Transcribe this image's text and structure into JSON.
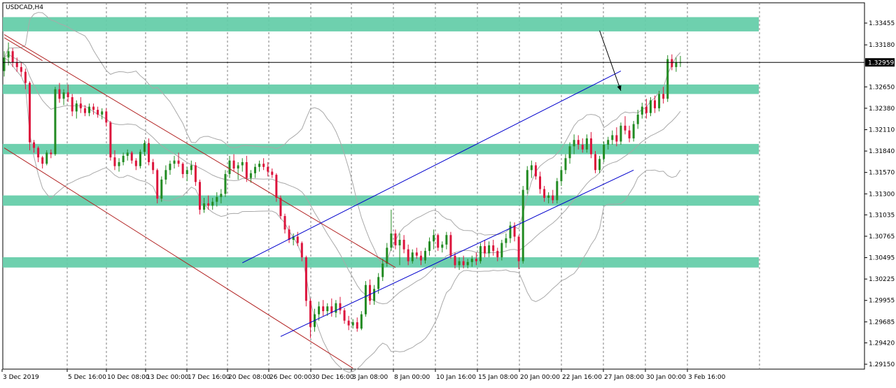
{
  "chart_data": {
    "type": "candlestick",
    "symbol_label": "USDCAD,H4",
    "current_price_label": "1.32959",
    "current_price": 1.32959,
    "ylim": [
      1.2905,
      1.3372
    ],
    "y_ticks": [
      "1.33455",
      "1.33180",
      "1.32650",
      "1.32380",
      "1.32110",
      "1.31840",
      "1.31570",
      "1.31300",
      "1.31035",
      "1.30765",
      "1.30495",
      "1.30225",
      "1.29955",
      "1.29685",
      "1.29420",
      "1.29150"
    ],
    "x_labels": [
      "3 Dec 2019",
      "5 Dec 16:00",
      "10 Dec 08:00",
      "13 Dec 00:00",
      "17 Dec 16:00",
      "20 Dec 08:00",
      "26 Dec 00:00",
      "30 Dec 16:00",
      "3 Jan 08:00",
      "8 Jan 00:00",
      "10 Jan 16:00",
      "15 Jan 08:00",
      "20 Jan 00:00",
      "22 Jan 16:00",
      "27 Jan 08:00",
      "30 Jan 00:00",
      "3 Feb 16:00"
    ],
    "bar_count": 160,
    "zones": [
      {
        "low": 1.3335,
        "high": 1.3353
      },
      {
        "low": 1.3256,
        "high": 1.3268
      },
      {
        "low": 1.318,
        "high": 1.3193
      },
      {
        "low": 1.3115,
        "high": 1.3128
      },
      {
        "low": 1.3037,
        "high": 1.305
      }
    ],
    "trend_lines": [
      {
        "color": "#b22222",
        "points": [
          [
            0,
            1.3327
          ],
          [
            9,
            1.3298
          ]
        ]
      },
      {
        "color": "#b22222",
        "points": [
          [
            0,
            1.3331
          ],
          [
            92,
            1.3037
          ]
        ]
      },
      {
        "color": "#b22222",
        "points": [
          [
            0,
            1.3188
          ],
          [
            82,
            1.291
          ]
        ]
      },
      {
        "color": "#0000cd",
        "points": [
          [
            56,
            1.3043
          ],
          [
            145,
            1.3285
          ]
        ]
      },
      {
        "color": "#0000cd",
        "points": [
          [
            65,
            1.295
          ],
          [
            148,
            1.316
          ]
        ]
      }
    ],
    "arrows": [
      {
        "color": "#000000",
        "from": [
          140,
          1.3336
        ],
        "to": [
          145,
          1.326
        ]
      }
    ],
    "ohlc": [
      [
        1.3285,
        1.331,
        1.3278,
        1.3302
      ],
      [
        1.3302,
        1.3321,
        1.3292,
        1.331
      ],
      [
        1.331,
        1.3314,
        1.329,
        1.3296
      ],
      [
        1.3296,
        1.3302,
        1.3284,
        1.329
      ],
      [
        1.329,
        1.3296,
        1.3278,
        1.3284
      ],
      [
        1.3284,
        1.3288,
        1.3262,
        1.327
      ],
      [
        1.327,
        1.3272,
        1.3185,
        1.3195
      ],
      [
        1.3195,
        1.3198,
        1.3182,
        1.3188
      ],
      [
        1.3188,
        1.319,
        1.317,
        1.3176
      ],
      [
        1.3176,
        1.3178,
        1.3162,
        1.3168
      ],
      [
        1.3168,
        1.3185,
        1.3166,
        1.3182
      ],
      [
        1.3182,
        1.3186,
        1.3175,
        1.318
      ],
      [
        1.318,
        1.3265,
        1.3178,
        1.3262
      ],
      [
        1.3262,
        1.327,
        1.3245,
        1.325
      ],
      [
        1.325,
        1.3262,
        1.3242,
        1.3258
      ],
      [
        1.3258,
        1.3268,
        1.3246,
        1.3252
      ],
      [
        1.3252,
        1.3256,
        1.3228,
        1.3234
      ],
      [
        1.3234,
        1.3248,
        1.3225,
        1.3244
      ],
      [
        1.3244,
        1.3252,
        1.3232,
        1.3238
      ],
      [
        1.3238,
        1.3242,
        1.3228,
        1.3232
      ],
      [
        1.3232,
        1.3244,
        1.3228,
        1.324
      ],
      [
        1.324,
        1.3244,
        1.323,
        1.3236
      ],
      [
        1.3236,
        1.324,
        1.3226,
        1.323
      ],
      [
        1.323,
        1.3238,
        1.3224,
        1.3234
      ],
      [
        1.3234,
        1.3238,
        1.3215,
        1.322
      ],
      [
        1.322,
        1.3222,
        1.3172,
        1.3176
      ],
      [
        1.3176,
        1.3185,
        1.316,
        1.3165
      ],
      [
        1.3165,
        1.3175,
        1.3158,
        1.317
      ],
      [
        1.317,
        1.3182,
        1.3166,
        1.3178
      ],
      [
        1.3178,
        1.3186,
        1.3172,
        1.3182
      ],
      [
        1.3182,
        1.3184,
        1.3168,
        1.3172
      ],
      [
        1.3172,
        1.3175,
        1.316,
        1.3165
      ],
      [
        1.3165,
        1.3186,
        1.3162,
        1.3183
      ],
      [
        1.3183,
        1.3198,
        1.3178,
        1.3194
      ],
      [
        1.3194,
        1.32,
        1.3166,
        1.317
      ],
      [
        1.317,
        1.3174,
        1.3155,
        1.316
      ],
      [
        1.316,
        1.3162,
        1.3118,
        1.3124
      ],
      [
        1.3124,
        1.3152,
        1.312,
        1.3148
      ],
      [
        1.3148,
        1.3166,
        1.3142,
        1.316
      ],
      [
        1.316,
        1.3172,
        1.3154,
        1.3168
      ],
      [
        1.3168,
        1.3178,
        1.3162,
        1.3172
      ],
      [
        1.3172,
        1.3182,
        1.3164,
        1.3168
      ],
      [
        1.3168,
        1.317,
        1.315,
        1.3155
      ],
      [
        1.3155,
        1.3164,
        1.3146,
        1.316
      ],
      [
        1.316,
        1.3172,
        1.3154,
        1.3166
      ],
      [
        1.3166,
        1.317,
        1.314,
        1.3145
      ],
      [
        1.3145,
        1.3148,
        1.3104,
        1.311
      ],
      [
        1.311,
        1.3125,
        1.3106,
        1.3118
      ],
      [
        1.3118,
        1.3128,
        1.311,
        1.3115
      ],
      [
        1.3115,
        1.3125,
        1.311,
        1.312
      ],
      [
        1.312,
        1.3132,
        1.3114,
        1.3126
      ],
      [
        1.3126,
        1.3136,
        1.3118,
        1.313
      ],
      [
        1.313,
        1.316,
        1.3126,
        1.3155
      ],
      [
        1.3155,
        1.3178,
        1.315,
        1.3172
      ],
      [
        1.3172,
        1.318,
        1.3158,
        1.3162
      ],
      [
        1.3162,
        1.317,
        1.3148,
        1.3166
      ],
      [
        1.3166,
        1.3175,
        1.3158,
        1.317
      ],
      [
        1.317,
        1.3178,
        1.3145,
        1.315
      ],
      [
        1.315,
        1.316,
        1.3144,
        1.3156
      ],
      [
        1.3156,
        1.3168,
        1.315,
        1.3164
      ],
      [
        1.3164,
        1.3172,
        1.3158,
        1.3168
      ],
      [
        1.3168,
        1.3175,
        1.316,
        1.3164
      ],
      [
        1.3164,
        1.317,
        1.3152,
        1.3158
      ],
      [
        1.3158,
        1.3162,
        1.315,
        1.3154
      ],
      [
        1.3154,
        1.3156,
        1.312,
        1.3125
      ],
      [
        1.3125,
        1.3128,
        1.3098,
        1.3102
      ],
      [
        1.3102,
        1.3105,
        1.308,
        1.3085
      ],
      [
        1.3085,
        1.309,
        1.3068,
        1.3072
      ],
      [
        1.3072,
        1.308,
        1.3065,
        1.3076
      ],
      [
        1.3076,
        1.3082,
        1.3064,
        1.3068
      ],
      [
        1.3068,
        1.307,
        1.3045,
        1.305
      ],
      [
        1.305,
        1.3052,
        1.2988,
        1.2995
      ],
      [
        1.2995,
        1.2998,
        1.2948,
        1.2962
      ],
      [
        1.2962,
        1.2985,
        1.2956,
        1.2978
      ],
      [
        1.2978,
        1.2994,
        1.297,
        1.2988
      ],
      [
        1.2988,
        1.2996,
        1.2976,
        1.2982
      ],
      [
        1.2982,
        1.2992,
        1.2976,
        1.2988
      ],
      [
        1.2988,
        1.2998,
        1.2975,
        1.298
      ],
      [
        1.298,
        1.2996,
        1.2974,
        1.2992
      ],
      [
        1.2992,
        1.3,
        1.2978,
        1.2983
      ],
      [
        1.2983,
        1.2986,
        1.2966,
        1.297
      ],
      [
        1.297,
        1.2976,
        1.2958,
        1.2964
      ],
      [
        1.2964,
        1.2972,
        1.296,
        1.2968
      ],
      [
        1.2968,
        1.2974,
        1.2956,
        1.296
      ],
      [
        1.296,
        1.2982,
        1.2958,
        1.2978
      ],
      [
        1.2978,
        1.302,
        1.2975,
        1.3015
      ],
      [
        1.3015,
        1.3022,
        1.299,
        1.2995
      ],
      [
        1.2995,
        1.3015,
        1.299,
        1.301
      ],
      [
        1.301,
        1.303,
        1.3004,
        1.3025
      ],
      [
        1.3025,
        1.3048,
        1.302,
        1.3042
      ],
      [
        1.3042,
        1.3068,
        1.3038,
        1.3062
      ],
      [
        1.3062,
        1.311,
        1.3058,
        1.308
      ],
      [
        1.308,
        1.3085,
        1.306,
        1.3065
      ],
      [
        1.3065,
        1.308,
        1.304,
        1.3072
      ],
      [
        1.3072,
        1.3078,
        1.3055,
        1.306
      ],
      [
        1.306,
        1.3066,
        1.304,
        1.3045
      ],
      [
        1.3045,
        1.306,
        1.3042,
        1.3056
      ],
      [
        1.3056,
        1.3062,
        1.3048,
        1.3052
      ],
      [
        1.3052,
        1.3058,
        1.304,
        1.3046
      ],
      [
        1.3046,
        1.3062,
        1.3042,
        1.3058
      ],
      [
        1.3058,
        1.3075,
        1.3052,
        1.307
      ],
      [
        1.307,
        1.3085,
        1.306,
        1.3078
      ],
      [
        1.3078,
        1.308,
        1.3058,
        1.3062
      ],
      [
        1.3062,
        1.307,
        1.3056,
        1.3066
      ],
      [
        1.3066,
        1.3082,
        1.306,
        1.3078
      ],
      [
        1.3078,
        1.3082,
        1.3048,
        1.3052
      ],
      [
        1.3052,
        1.3056,
        1.3036,
        1.304
      ],
      [
        1.304,
        1.305,
        1.3034,
        1.3045
      ],
      [
        1.3045,
        1.3052,
        1.3036,
        1.304
      ],
      [
        1.304,
        1.3048,
        1.3036,
        1.3044
      ],
      [
        1.3044,
        1.3052,
        1.3038,
        1.3048
      ],
      [
        1.3048,
        1.3056,
        1.304,
        1.3045
      ],
      [
        1.3045,
        1.3068,
        1.3042,
        1.3064
      ],
      [
        1.3064,
        1.3072,
        1.305,
        1.3055
      ],
      [
        1.3055,
        1.307,
        1.305,
        1.3065
      ],
      [
        1.3065,
        1.3072,
        1.3052,
        1.3058
      ],
      [
        1.3058,
        1.3062,
        1.3045,
        1.305
      ],
      [
        1.305,
        1.3072,
        1.3046,
        1.3068
      ],
      [
        1.3068,
        1.308,
        1.3062,
        1.3074
      ],
      [
        1.3074,
        1.3095,
        1.3068,
        1.309
      ],
      [
        1.309,
        1.3094,
        1.307,
        1.3076
      ],
      [
        1.3076,
        1.3078,
        1.3035,
        1.3045
      ],
      [
        1.3045,
        1.314,
        1.3042,
        1.3135
      ],
      [
        1.3135,
        1.3165,
        1.313,
        1.316
      ],
      [
        1.316,
        1.3172,
        1.315,
        1.3166
      ],
      [
        1.3166,
        1.317,
        1.3148,
        1.3152
      ],
      [
        1.3152,
        1.3158,
        1.313,
        1.3136
      ],
      [
        1.3136,
        1.314,
        1.312,
        1.3125
      ],
      [
        1.3125,
        1.3132,
        1.3118,
        1.3128
      ],
      [
        1.3128,
        1.3135,
        1.3118,
        1.3122
      ],
      [
        1.3122,
        1.315,
        1.3118,
        1.3146
      ],
      [
        1.3146,
        1.3165,
        1.314,
        1.316
      ],
      [
        1.316,
        1.318,
        1.3155,
        1.3175
      ],
      [
        1.3175,
        1.3195,
        1.3168,
        1.319
      ],
      [
        1.319,
        1.3205,
        1.318,
        1.3198
      ],
      [
        1.3198,
        1.3204,
        1.3186,
        1.3192
      ],
      [
        1.3192,
        1.32,
        1.3182,
        1.3186
      ],
      [
        1.3186,
        1.3205,
        1.3182,
        1.32
      ],
      [
        1.32,
        1.3208,
        1.3175,
        1.318
      ],
      [
        1.318,
        1.3184,
        1.3156,
        1.316
      ],
      [
        1.316,
        1.3178,
        1.3156,
        1.3174
      ],
      [
        1.3174,
        1.3196,
        1.317,
        1.3192
      ],
      [
        1.3192,
        1.3202,
        1.3186,
        1.3198
      ],
      [
        1.3198,
        1.321,
        1.3192,
        1.3204
      ],
      [
        1.3204,
        1.3214,
        1.319,
        1.3196
      ],
      [
        1.3196,
        1.322,
        1.3192,
        1.3216
      ],
      [
        1.3216,
        1.3228,
        1.3205,
        1.321
      ],
      [
        1.321,
        1.3216,
        1.3195,
        1.32
      ],
      [
        1.32,
        1.3222,
        1.3196,
        1.3218
      ],
      [
        1.3218,
        1.3236,
        1.3212,
        1.323
      ],
      [
        1.323,
        1.3245,
        1.3225,
        1.324
      ],
      [
        1.324,
        1.325,
        1.3225,
        1.3232
      ],
      [
        1.3232,
        1.3252,
        1.3228,
        1.3248
      ],
      [
        1.3248,
        1.3254,
        1.3232,
        1.3238
      ],
      [
        1.3238,
        1.326,
        1.3234,
        1.3256
      ],
      [
        1.3256,
        1.3265,
        1.3244,
        1.325
      ],
      [
        1.325,
        1.3305,
        1.3246,
        1.33
      ],
      [
        1.33,
        1.3306,
        1.3286,
        1.329
      ],
      [
        1.329,
        1.3302,
        1.3284,
        1.3296
      ],
      [
        1.3296,
        1.3304,
        1.329,
        1.3296
      ]
    ]
  }
}
